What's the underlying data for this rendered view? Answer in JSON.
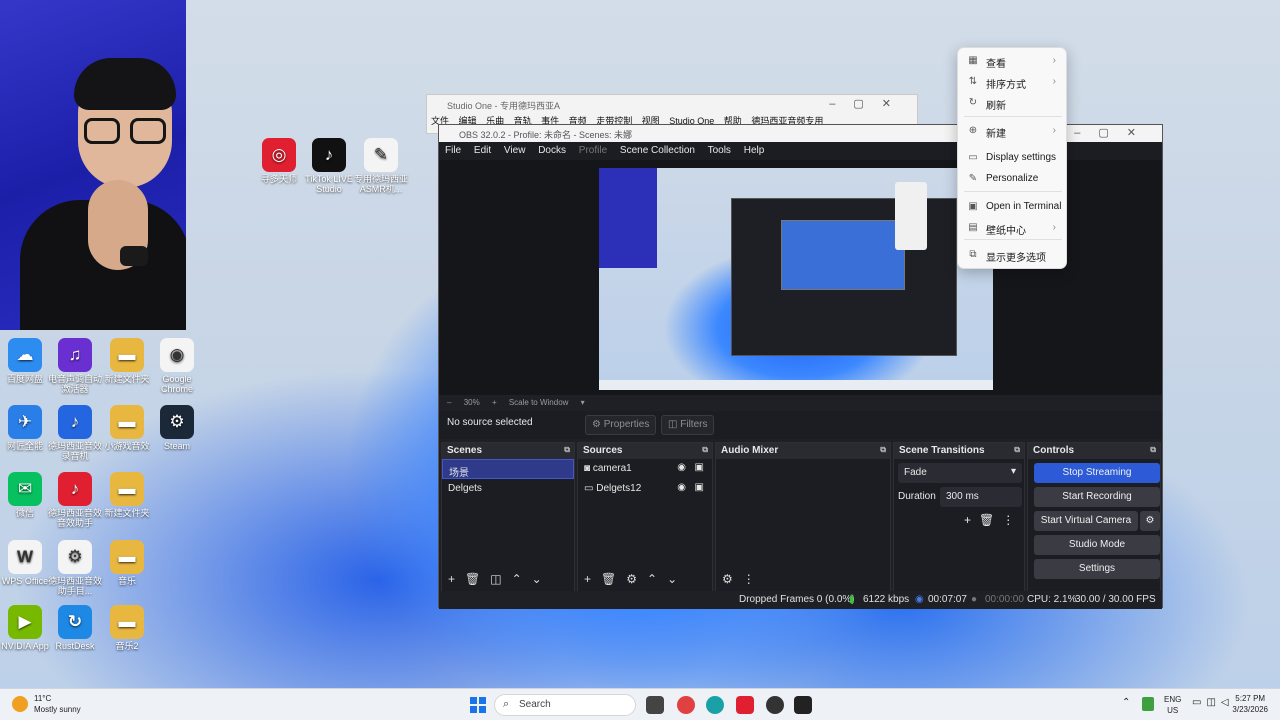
{
  "desktop": {
    "icons": [
      {
        "label": "寻多天师",
        "color": "#e02030",
        "glyph": "◎"
      },
      {
        "label": "TikTok LIVE Studio",
        "color": "#111111",
        "glyph": "♪"
      },
      {
        "label": "专用德玛西亚ASMR机...",
        "color": "#f4f4f4",
        "glyph": "✎"
      },
      {
        "label": "百度网盘",
        "color": "#2d8cf0",
        "glyph": "☁"
      },
      {
        "label": "电音声调自动激活器",
        "color": "#6a2fd0",
        "glyph": "♫"
      },
      {
        "label": "新建文件夹",
        "color": "#e8b740",
        "glyph": "▬"
      },
      {
        "label": "Google Chrome",
        "color": "#f4f4f4",
        "glyph": "◉"
      },
      {
        "label": "网匠全能",
        "color": "#2a7ee8",
        "glyph": "✈"
      },
      {
        "label": "德玛西亚音效录音机",
        "color": "#2466e0",
        "glyph": "♪"
      },
      {
        "label": "小游戏音效",
        "color": "#e8b740",
        "glyph": "▬"
      },
      {
        "label": "Steam",
        "color": "#1b2838",
        "glyph": "⚙"
      },
      {
        "label": "微信",
        "color": "#07c160",
        "glyph": "✉"
      },
      {
        "label": "德玛西亚音效音效助手",
        "color": "#e02030",
        "glyph": "♪"
      },
      {
        "label": "新建文件夹",
        "color": "#e8b740",
        "glyph": "▬"
      },
      {
        "label": "WPS Office",
        "color": "#f4f4f4",
        "glyph": "W"
      },
      {
        "label": "德玛西亚音效助手目...",
        "color": "#f4f4f4",
        "glyph": "⚙"
      },
      {
        "label": "音乐",
        "color": "#e8b740",
        "glyph": "▬"
      },
      {
        "label": "NVIDIA App",
        "color": "#76b900",
        "glyph": "▶"
      },
      {
        "label": "RustDesk",
        "color": "#1e88e5",
        "glyph": "↻"
      },
      {
        "label": "音乐2",
        "color": "#e8b740",
        "glyph": "▬"
      }
    ]
  },
  "studio_one": {
    "title": "Studio One - 专用德玛西亚A",
    "menu": [
      "文件",
      "编辑",
      "乐曲",
      "音轨",
      "事件",
      "音频",
      "走带控制",
      "视图",
      "Studio One",
      "帮助",
      "德玛西亚音频专用"
    ]
  },
  "obs": {
    "title": "OBS 32.0.2 - Profile: 未命名 - Scenes: 未娜",
    "menu": [
      {
        "label": "File",
        "dim": false
      },
      {
        "label": "Edit",
        "dim": false
      },
      {
        "label": "View",
        "dim": false
      },
      {
        "label": "Docks",
        "dim": false
      },
      {
        "label": "Profile",
        "dim": true
      },
      {
        "label": "Scene Collection",
        "dim": false
      },
      {
        "label": "Tools",
        "dim": false
      },
      {
        "label": "Help",
        "dim": false
      }
    ],
    "preview_zoom": "30%",
    "scale_mode": "Scale to Window",
    "no_source": "No source selected",
    "properties_btn": "Properties",
    "filters_btn": "Filters",
    "docks": {
      "scenes": {
        "title": "Scenes",
        "items": [
          "场景",
          "Delgets"
        ]
      },
      "sources": {
        "title": "Sources",
        "items": [
          "camera1",
          "Delgets12"
        ]
      },
      "mixer": {
        "title": "Audio Mixer"
      },
      "transitions": {
        "title": "Scene Transitions",
        "type": "Fade",
        "duration_label": "Duration",
        "duration_value": "300 ms"
      },
      "controls": {
        "title": "Controls",
        "stop_streaming": "Stop Streaming",
        "start_recording": "Start Recording",
        "start_virtual_camera": "Start Virtual Camera",
        "studio_mode": "Studio Mode",
        "settings": "Settings"
      }
    },
    "status": {
      "dropped_frames": "Dropped Frames 0 (0.0%)",
      "bitrate": "6122 kbps",
      "stream_time": "00:07:07",
      "rec_time": "00:00:00",
      "cpu": "CPU: 2.1%",
      "fps": "30.00 / 30.00 FPS"
    }
  },
  "context_menu": {
    "items": [
      {
        "label": "查看",
        "icon": "grid-icon",
        "glyph": "▦",
        "sub": true
      },
      {
        "label": "排序方式",
        "icon": "sort-icon",
        "glyph": "⇅",
        "sub": true
      },
      {
        "label": "刷新",
        "icon": "refresh-icon",
        "glyph": "↻",
        "sub": false
      },
      {
        "label": "新建",
        "icon": "plus-circle-icon",
        "glyph": "⊕",
        "sub": true
      },
      {
        "label": "Display settings",
        "icon": "display-icon",
        "glyph": "▭",
        "sub": false
      },
      {
        "label": "Personalize",
        "icon": "brush-icon",
        "glyph": "✎",
        "sub": false
      },
      {
        "label": "Open in Terminal",
        "icon": "terminal-icon",
        "glyph": "▣",
        "sub": false
      },
      {
        "label": "壁纸中心",
        "icon": "wallpaper-icon",
        "glyph": "▤",
        "sub": true
      },
      {
        "label": "显示更多选项",
        "icon": "more-options-icon",
        "glyph": "⧉",
        "sub": false
      }
    ]
  },
  "taskbar": {
    "weather_temp": "11°C",
    "weather_desc": "Mostly sunny",
    "search_placeholder": "Search",
    "lang_top": "ENG",
    "lang_bottom": "US",
    "time": "5:27 PM",
    "date": "3/23/2026"
  }
}
